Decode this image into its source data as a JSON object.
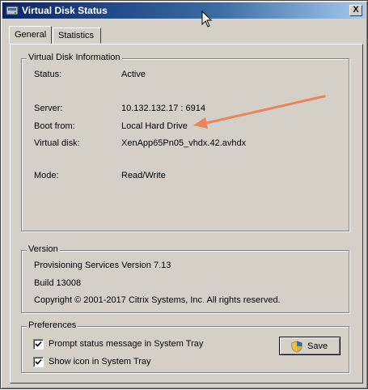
{
  "window": {
    "title": "Virtual Disk Status",
    "close_label": "X"
  },
  "tabs": [
    {
      "label": "General",
      "active": true
    },
    {
      "label": "Statistics",
      "active": false
    }
  ],
  "info": {
    "title": "Virtual Disk Information",
    "rows": [
      {
        "label": "Status:",
        "value": "Active"
      },
      {
        "label": "Server:",
        "value": "10.132.132.17 : 6914"
      },
      {
        "label": "Boot from:",
        "value": "Local Hard Drive"
      },
      {
        "label": "Virtual disk:",
        "value": "XenApp65Pn05_vhdx.42.avhdx"
      },
      {
        "label": "Mode:",
        "value": "Read/Write"
      }
    ]
  },
  "version": {
    "title": "Version",
    "lines": [
      "Provisioning Services Version 7.13",
      "Build 13008",
      "Copyright © 2001-2017 Citrix Systems, Inc. All rights reserved."
    ]
  },
  "preferences": {
    "title": "Preferences",
    "options": [
      {
        "label": "Prompt status message in System Tray",
        "checked": true
      },
      {
        "label": "Show icon in System Tray",
        "checked": true
      }
    ],
    "save_label": "Save"
  },
  "colors": {
    "titlebar_start": "#0a246a",
    "face": "#d4d0c8",
    "annotation_arrow": "#e8845e"
  },
  "icons": {
    "title": "app-disk-icon",
    "save": "uac-shield-icon",
    "annotation": "arrow-annotation"
  }
}
